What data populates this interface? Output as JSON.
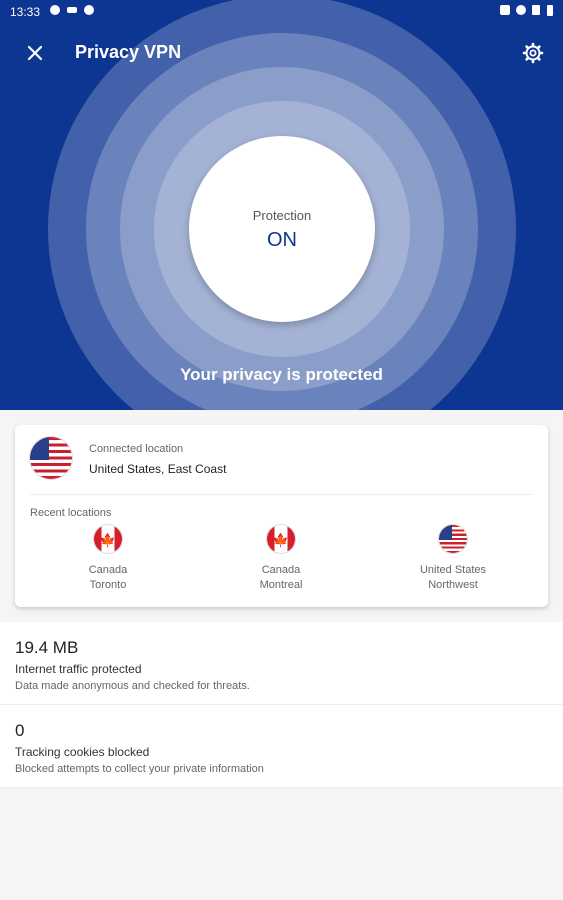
{
  "status_bar": {
    "time": "13:33"
  },
  "app_bar": {
    "title": "Privacy VPN",
    "close_icon": "close-icon",
    "settings_icon": "gear-icon"
  },
  "protection": {
    "label": "Protection",
    "state": "ON",
    "message": "Your privacy is protected"
  },
  "colors": {
    "primary": "#0d3592",
    "ring_fill": "#ffffff"
  },
  "connected": {
    "label": "Connected location",
    "value": "United States, East Coast",
    "flag": "us-flag"
  },
  "recent": {
    "label": "Recent locations",
    "items": [
      {
        "country": "Canada",
        "city": "Toronto",
        "flag": "canada-flag"
      },
      {
        "country": "Canada",
        "city": "Montreal",
        "flag": "canada-flag"
      },
      {
        "country": "United States",
        "city": "Northwest",
        "flag": "us-flag"
      }
    ]
  },
  "stats": [
    {
      "value": "19.4 MB",
      "title": "Internet traffic protected",
      "subtitle": "Data made anonymous and checked for threats."
    },
    {
      "value": "0",
      "title": "Tracking cookies blocked",
      "subtitle": "Blocked attempts to collect your private information"
    }
  ]
}
